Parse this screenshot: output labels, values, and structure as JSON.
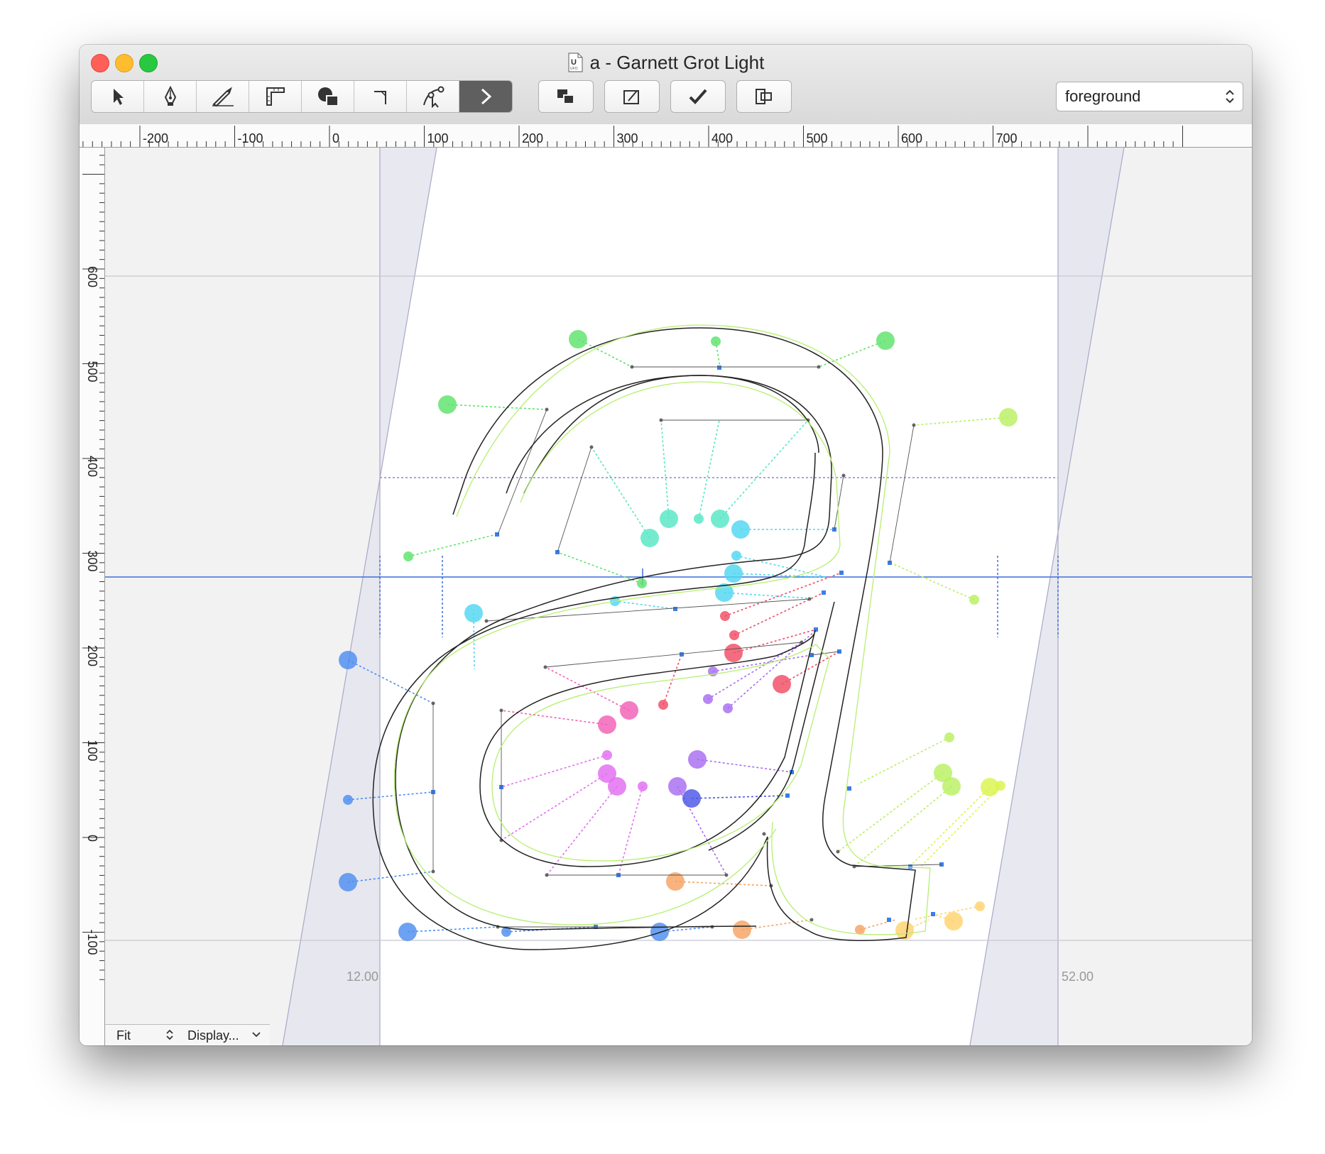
{
  "window": {
    "title": "a - Garnett Grot Light",
    "file_icon": "ufo-document-icon"
  },
  "toolbar": {
    "tools": [
      {
        "name": "selection-tool",
        "icon": "arrow-cursor-icon",
        "active": false
      },
      {
        "name": "pen-tool",
        "icon": "pen-nib-icon",
        "active": false
      },
      {
        "name": "knife-tool",
        "icon": "knife-icon",
        "active": false
      },
      {
        "name": "measure-tool",
        "icon": "ruler-icon",
        "active": false
      },
      {
        "name": "shapes-tool",
        "icon": "shapes-icon",
        "active": false
      },
      {
        "name": "corner-tool",
        "icon": "corner-icon",
        "active": false
      },
      {
        "name": "node-tool",
        "icon": "node-tool-icon",
        "active": false
      },
      {
        "name": "next-tool",
        "icon": "chevron-right-icon",
        "active": true
      }
    ],
    "buttons": [
      {
        "name": "layers-button",
        "icon": "overlap-squares-icon"
      },
      {
        "name": "transform-button",
        "icon": "transform-frame-icon"
      },
      {
        "name": "validate-button",
        "icon": "checkmark-icon"
      },
      {
        "name": "compare-button",
        "icon": "compare-frames-icon"
      }
    ],
    "layer_select": {
      "value": "foreground"
    }
  },
  "rulers": {
    "horizontal": [
      "-200",
      "-100",
      "0",
      "100",
      "200",
      "300",
      "400",
      "500",
      "600",
      "700"
    ],
    "vertical": [
      "600",
      "500",
      "400",
      "300",
      "200",
      "100",
      "0",
      "-100"
    ]
  },
  "canvas": {
    "left_margin_label": "12.00",
    "right_margin_label": "52.00",
    "colors": {
      "guide": "#3a6fdc",
      "metrics": "#a8a8c8",
      "outline": "#222222",
      "green": "#5ee36b",
      "teal": "#55e7c4",
      "cyan": "#4fd7f2",
      "blue": "#4d8ef0",
      "red": "#f24c64",
      "pink": "#f25fb6",
      "magenta": "#e26df0",
      "violet": "#a76cf0",
      "indigo": "#4a55e6",
      "orange": "#f7a262",
      "yellow": "#ffd36e",
      "lime": "#dbf44c",
      "yellowgreen": "#b8f060"
    }
  },
  "statusbar": {
    "zoom": "Fit",
    "display": "Display..."
  }
}
